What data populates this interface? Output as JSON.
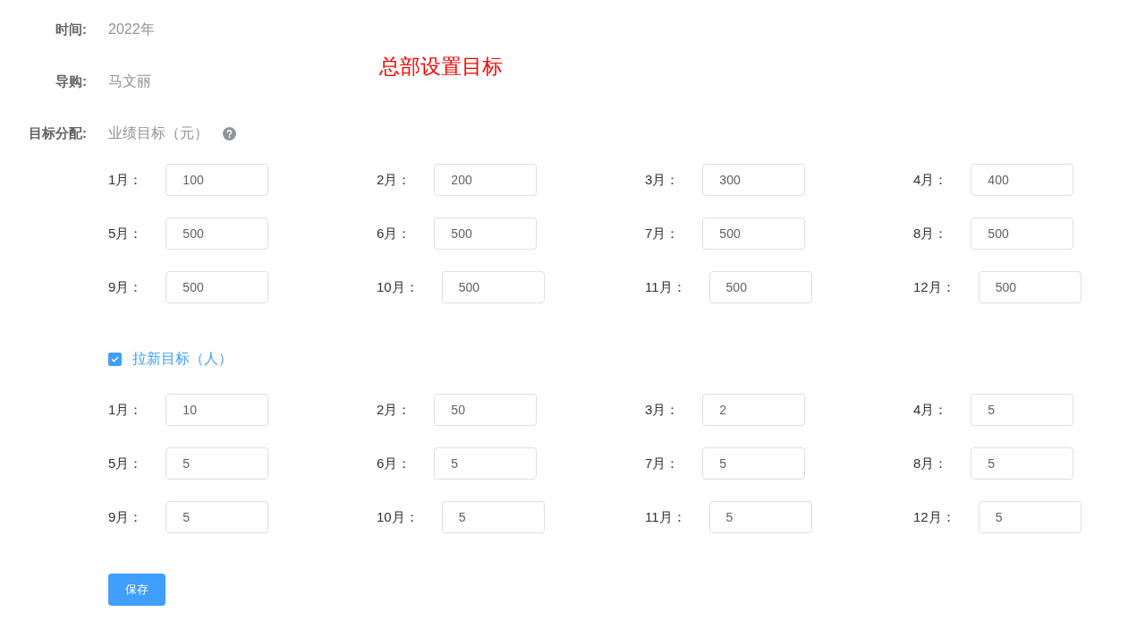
{
  "info": [
    {
      "label": "时间:",
      "value": "2022年"
    },
    {
      "label": "导购:",
      "value": "马文丽"
    }
  ],
  "heading": "总部设置目标",
  "allocation_label": "目标分配:",
  "sections": [
    {
      "kind": "help",
      "label": "业绩目标（元）",
      "months": [
        {
          "label": "1月：",
          "value": "100"
        },
        {
          "label": "2月：",
          "value": "200"
        },
        {
          "label": "3月：",
          "value": "300"
        },
        {
          "label": "4月：",
          "value": "400"
        },
        {
          "label": "5月：",
          "value": "500"
        },
        {
          "label": "6月：",
          "value": "500"
        },
        {
          "label": "7月：",
          "value": "500"
        },
        {
          "label": "8月：",
          "value": "500"
        },
        {
          "label": "9月：",
          "value": "500"
        },
        {
          "label": "10月：",
          "value": "500"
        },
        {
          "label": "11月：",
          "value": "500"
        },
        {
          "label": "12月：",
          "value": "500"
        }
      ]
    },
    {
      "kind": "checkbox",
      "checked": true,
      "label": "拉新目标（人）",
      "months": [
        {
          "label": "1月：",
          "value": "10"
        },
        {
          "label": "2月：",
          "value": "50"
        },
        {
          "label": "3月：",
          "value": "2"
        },
        {
          "label": "4月：",
          "value": "5"
        },
        {
          "label": "5月：",
          "value": "5"
        },
        {
          "label": "6月：",
          "value": "5"
        },
        {
          "label": "7月：",
          "value": "5"
        },
        {
          "label": "8月：",
          "value": "5"
        },
        {
          "label": "9月：",
          "value": "5"
        },
        {
          "label": "10月：",
          "value": "5"
        },
        {
          "label": "11月：",
          "value": "5"
        },
        {
          "label": "12月：",
          "value": "5"
        }
      ]
    }
  ],
  "save_button": "保存"
}
